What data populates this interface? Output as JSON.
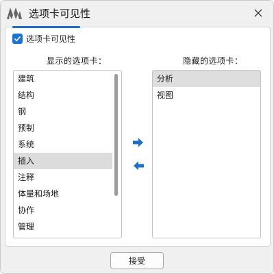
{
  "window": {
    "title": "选项卡可见性",
    "close_icon": "close-icon",
    "logo_icon": "app-logo-icon"
  },
  "visibility_checkbox": {
    "label": "选项卡可见性",
    "checked": true
  },
  "shown_tabs": {
    "header": "显示的选项卡：",
    "items": [
      "建筑",
      "结构",
      "钢",
      "预制",
      "系统",
      "插入",
      "注释",
      "体量和场地",
      "协作",
      "管理"
    ],
    "selected": "插入"
  },
  "hidden_tabs": {
    "header": "隐藏的选项卡：",
    "items": [
      "分析",
      "视图"
    ],
    "selected": "分析"
  },
  "move_buttons": {
    "to_hidden_icon": "arrow-right-icon",
    "to_shown_icon": "arrow-left-icon"
  },
  "footer": {
    "accept_label": "接受"
  },
  "colors": {
    "accent": "#1f6fc5",
    "selection": "#dedede"
  }
}
